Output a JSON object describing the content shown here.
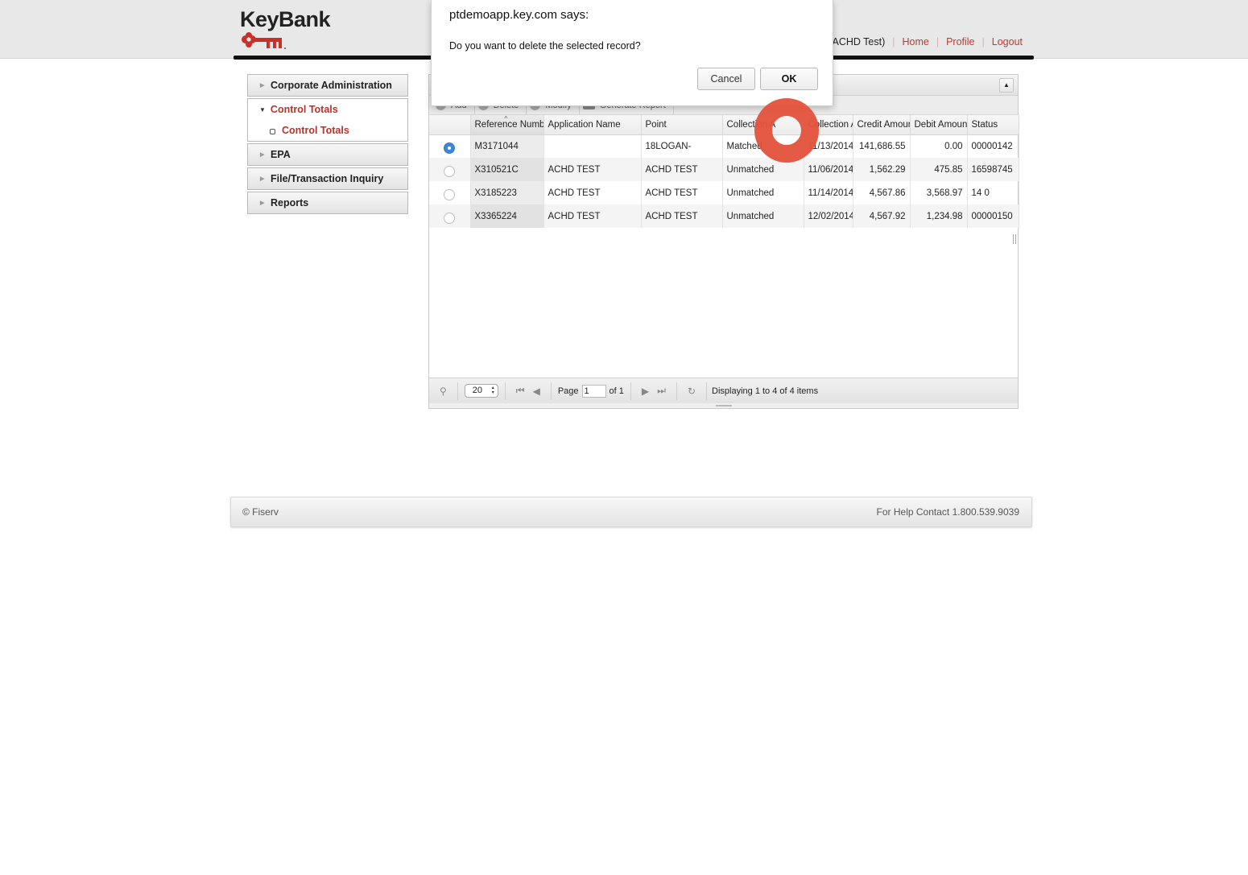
{
  "header": {
    "logo_text": "KeyBank",
    "user_name": "h (ACHD Test)",
    "links": [
      "Home",
      "Profile",
      "Logout"
    ]
  },
  "sidebar": {
    "items": [
      {
        "label": "Corporate Administration",
        "expanded": false
      },
      {
        "label": "Control Totals",
        "expanded": true,
        "children": [
          {
            "label": "Control Totals",
            "active": true
          }
        ]
      },
      {
        "label": "EPA",
        "expanded": false
      },
      {
        "label": "File/Transaction Inquiry",
        "expanded": false
      },
      {
        "label": "Reports",
        "expanded": false
      }
    ]
  },
  "toolbar": {
    "buttons": [
      "Add",
      "Delete",
      "Modify",
      "Generate Report"
    ]
  },
  "grid": {
    "columns": [
      "",
      "Reference Numbe",
      "Application Name",
      "Point",
      "Collection A",
      "Collection A",
      "Credit Amour",
      "Debit Amount",
      "Status"
    ],
    "rows": [
      {
        "selected": true,
        "ref": "M3171044",
        "app": "",
        "point": "18LOGAN-",
        "collection": "Matched",
        "date": "11/13/2014",
        "credit": "141,686.55",
        "debit": "0.00",
        "status": "00000142"
      },
      {
        "selected": false,
        "ref": "X310521C",
        "app": "ACHD TEST",
        "point": "ACHD TEST",
        "collection": "Unmatched",
        "date": "11/06/2014",
        "credit": "1,562.29",
        "debit": "475.85",
        "status": "16598745"
      },
      {
        "selected": false,
        "ref": "X3185223",
        "app": "ACHD TEST",
        "point": "ACHD TEST",
        "collection": "Unmatched",
        "date": "11/14/2014",
        "credit": "4,567.86",
        "debit": "3,568.97",
        "status": "14 0"
      },
      {
        "selected": false,
        "ref": "X3365224",
        "app": "ACHD TEST",
        "point": "ACHD TEST",
        "collection": "Unmatched",
        "date": "12/02/2014",
        "credit": "4,567.92",
        "debit": "1,234.98",
        "status": "00000150"
      }
    ]
  },
  "pager": {
    "page_size": "20",
    "page_label": "Page",
    "page_value": "1",
    "of_label": "of 1",
    "display_text": "Displaying 1 to 4 of 4 items"
  },
  "footer": {
    "copyright": "© Fiserv",
    "help": "For Help Contact 1.800.539.9039"
  },
  "dialog": {
    "title": "ptdemoapp.key.com says:",
    "message": "Do you want to delete the selected record?",
    "cancel_label": "Cancel",
    "ok_label": "OK"
  },
  "colors": {
    "brand_red": "#c0392b",
    "active_nav": "#b8322a",
    "click_marker": "#e3533c",
    "radio_selected": "#3f86d6"
  }
}
